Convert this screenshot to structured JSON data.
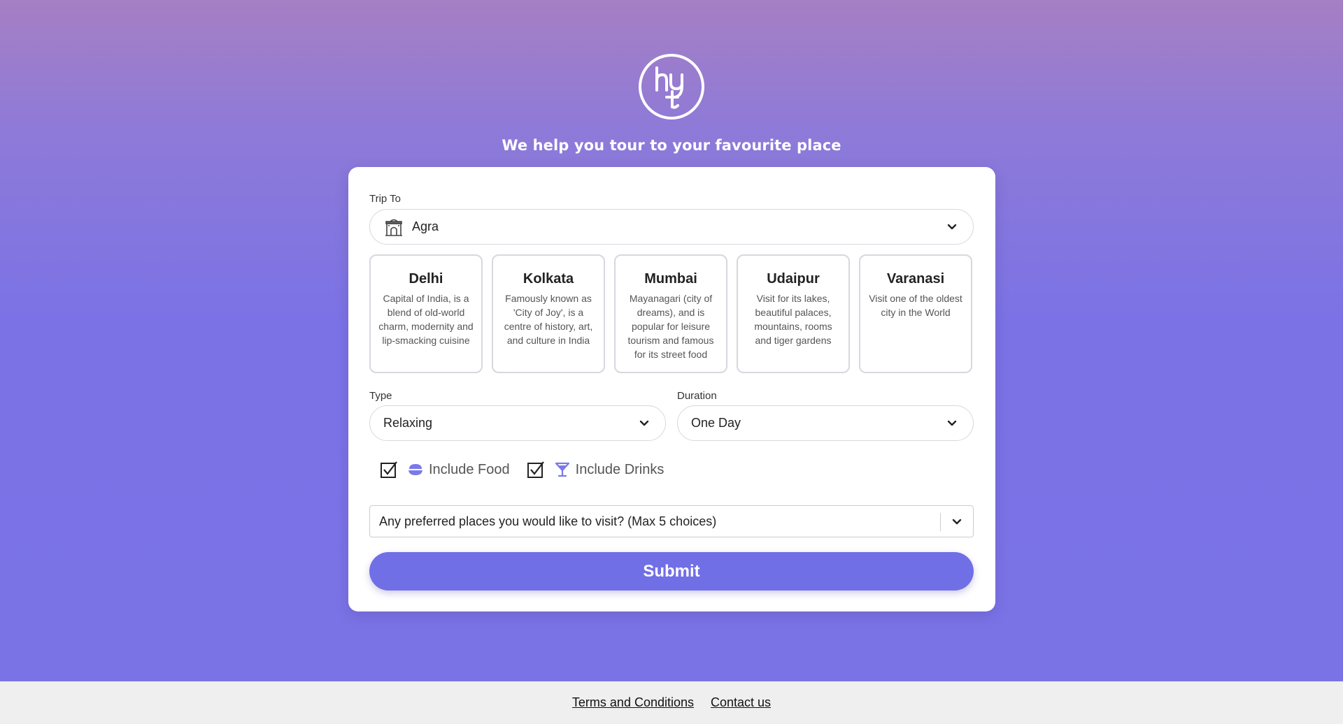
{
  "logo": {
    "icon": "hyt-monogram-logo"
  },
  "tagline": "We help you tour to your favourite place",
  "form": {
    "trip_to": {
      "label": "Trip To",
      "value": "Agra",
      "icon": "monument-icon"
    },
    "cities": [
      {
        "name": "Delhi",
        "description": "Capital of India, is a blend of old-world charm, modernity and lip-smacking cuisine"
      },
      {
        "name": "Kolkata",
        "description": "Famously known as 'City of Joy', is a centre of history, art, and culture in India"
      },
      {
        "name": "Mumbai",
        "description": "Mayanagari (city of dreams), and is popular for leisure tourism and famous for its street food"
      },
      {
        "name": "Udaipur",
        "description": "Visit for its lakes, beautiful palaces, mountains, rooms and tiger gardens"
      },
      {
        "name": "Varanasi",
        "description": "Visit one of the oldest city in the World"
      }
    ],
    "type": {
      "label": "Type",
      "value": "Relaxing"
    },
    "duration": {
      "label": "Duration",
      "value": "One Day"
    },
    "include_food": {
      "label": "Include Food",
      "checked": true,
      "icon": "food-bowl-icon"
    },
    "include_drinks": {
      "label": "Include Drinks",
      "checked": true,
      "icon": "cocktail-glass-icon"
    },
    "preferred_places": {
      "placeholder": "Any preferred places you would like to visit? (Max 5 choices)"
    },
    "submit_label": "Submit"
  },
  "footer": {
    "terms": "Terms and Conditions",
    "contact": "Contact us"
  },
  "colors": {
    "accent": "#716fe6",
    "background_top": "#a67fc4",
    "background_bottom": "#7a73e6",
    "footer_bg": "#efefef"
  }
}
